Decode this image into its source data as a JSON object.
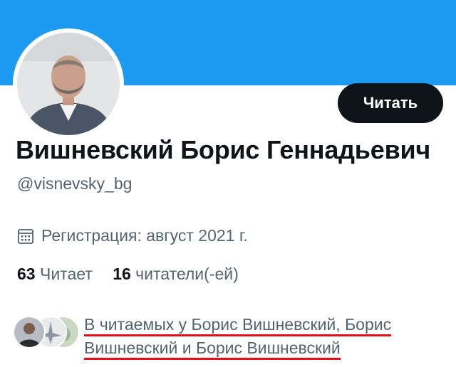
{
  "profile": {
    "display_name": "Вишневский Борис Геннадьевич",
    "handle": "@visnevsky_bg",
    "follow_label": "Читать",
    "joined": "Регистрация: август 2021 г.",
    "following_count": "63",
    "following_label": "Читает",
    "followers_count": "16",
    "followers_label": "читатели(-ей)",
    "followed_by_line1": "В читаемых у Борис Вишневский, Борис",
    "followed_by_line2": "Вишневский и Борис Вишневский"
  },
  "colors": {
    "banner": "#1d9bf0",
    "button": "#0f1419",
    "secondary_text": "#536471",
    "annotation_underline": "#e0101a"
  },
  "icons": {
    "calendar": "calendar-icon"
  }
}
